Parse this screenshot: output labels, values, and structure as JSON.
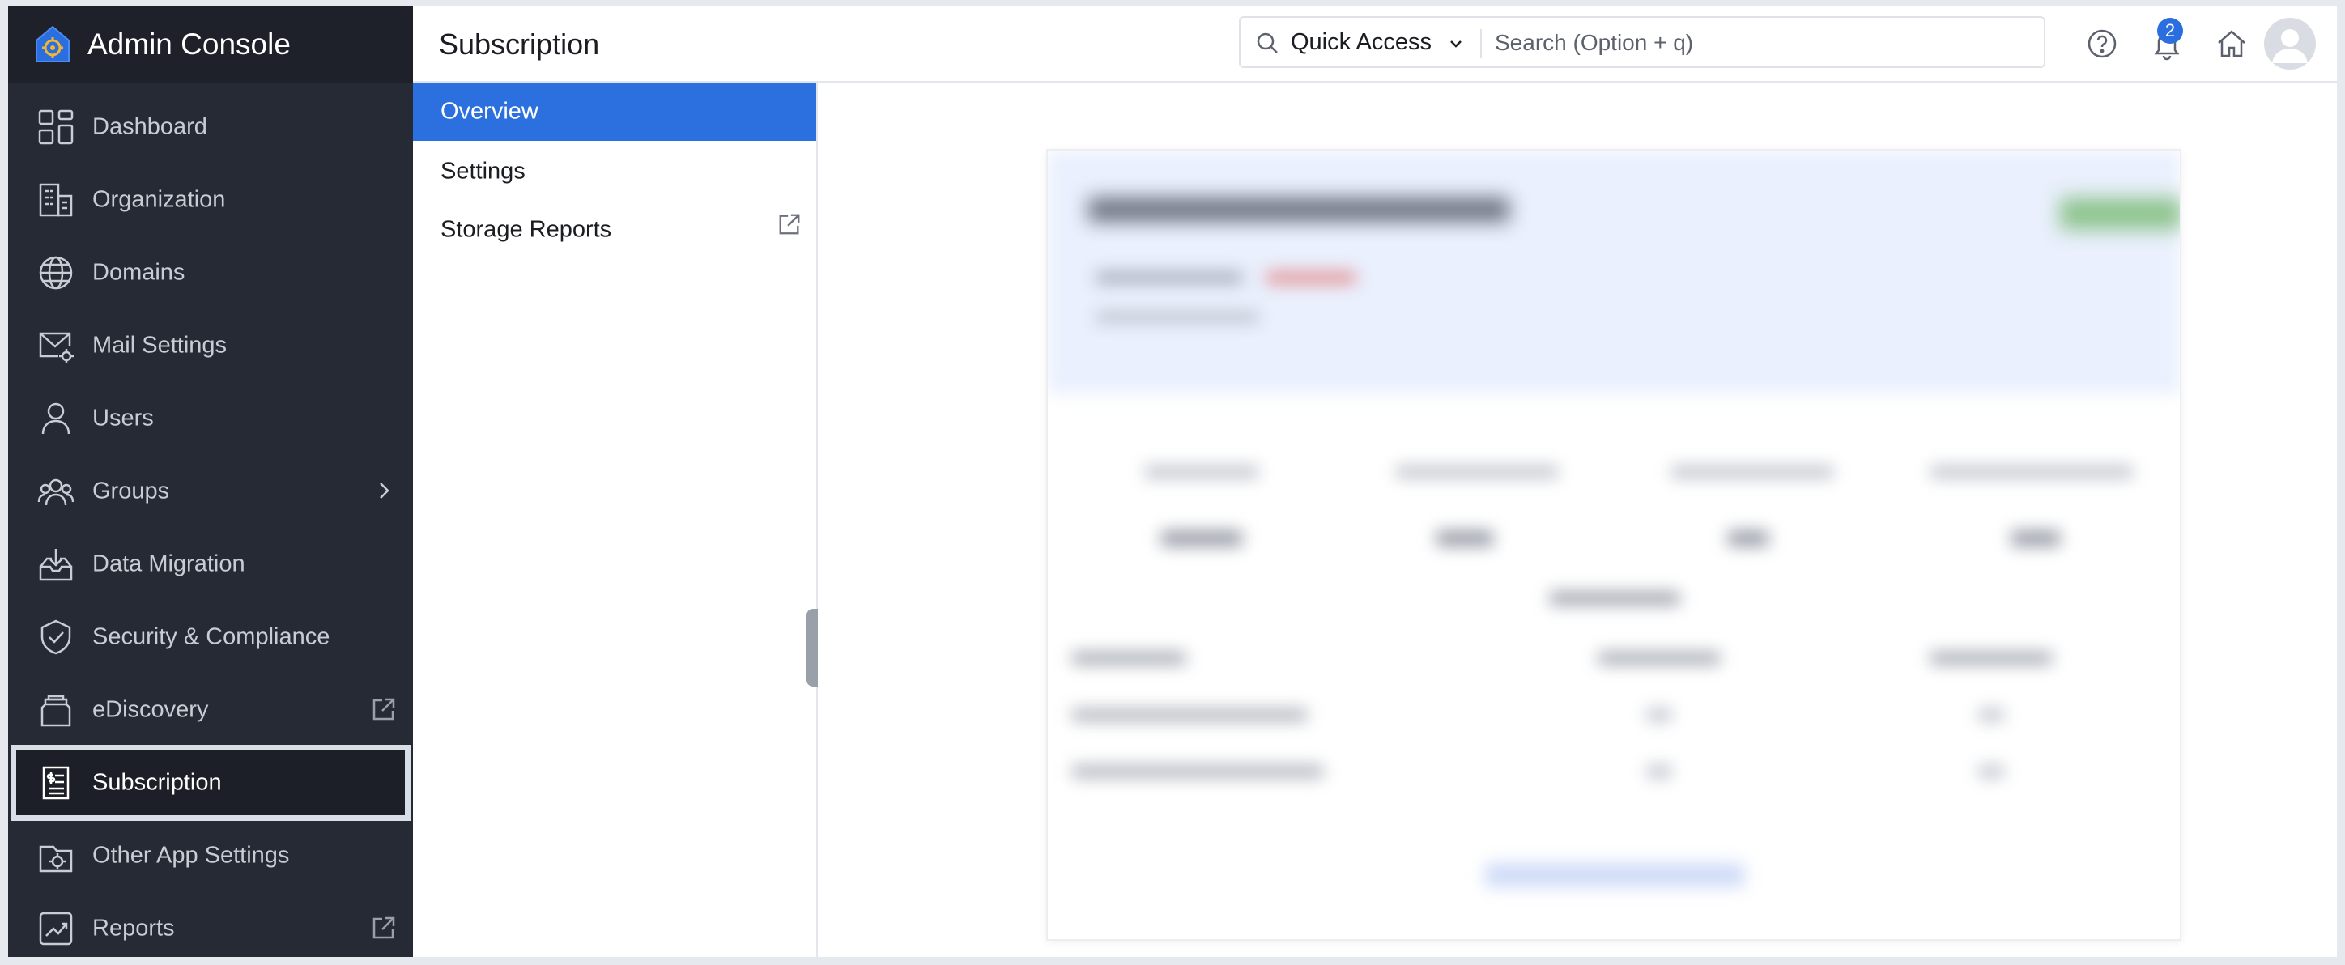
{
  "app": {
    "title": "Admin Console"
  },
  "sidebar": {
    "items": [
      {
        "label": "Dashboard",
        "icon": "dashboard-icon"
      },
      {
        "label": "Organization",
        "icon": "organization-icon"
      },
      {
        "label": "Domains",
        "icon": "globe-icon"
      },
      {
        "label": "Mail Settings",
        "icon": "mail-settings-icon"
      },
      {
        "label": "Users",
        "icon": "user-icon"
      },
      {
        "label": "Groups",
        "icon": "groups-icon"
      },
      {
        "label": "Data Migration",
        "icon": "data-migration-icon"
      },
      {
        "label": "Security & Compliance",
        "icon": "shield-icon"
      },
      {
        "label": "eDiscovery",
        "icon": "ediscovery-icon"
      },
      {
        "label": "Subscription",
        "icon": "subscription-icon",
        "active": true
      },
      {
        "label": "Other App Settings",
        "icon": "app-settings-icon"
      },
      {
        "label": "Reports",
        "icon": "reports-icon"
      }
    ]
  },
  "header": {
    "page_title": "Subscription",
    "quick_access_label": "Quick Access",
    "search_placeholder": "Search (Option + q)",
    "notification_count": "2"
  },
  "subnav": {
    "items": [
      {
        "label": "Overview",
        "active": true
      },
      {
        "label": "Settings"
      },
      {
        "label": "Storage Reports"
      }
    ]
  },
  "colors": {
    "sidebar_bg": "#262a34",
    "accent": "#2c6fdf",
    "badge": "#2b6ee0"
  }
}
